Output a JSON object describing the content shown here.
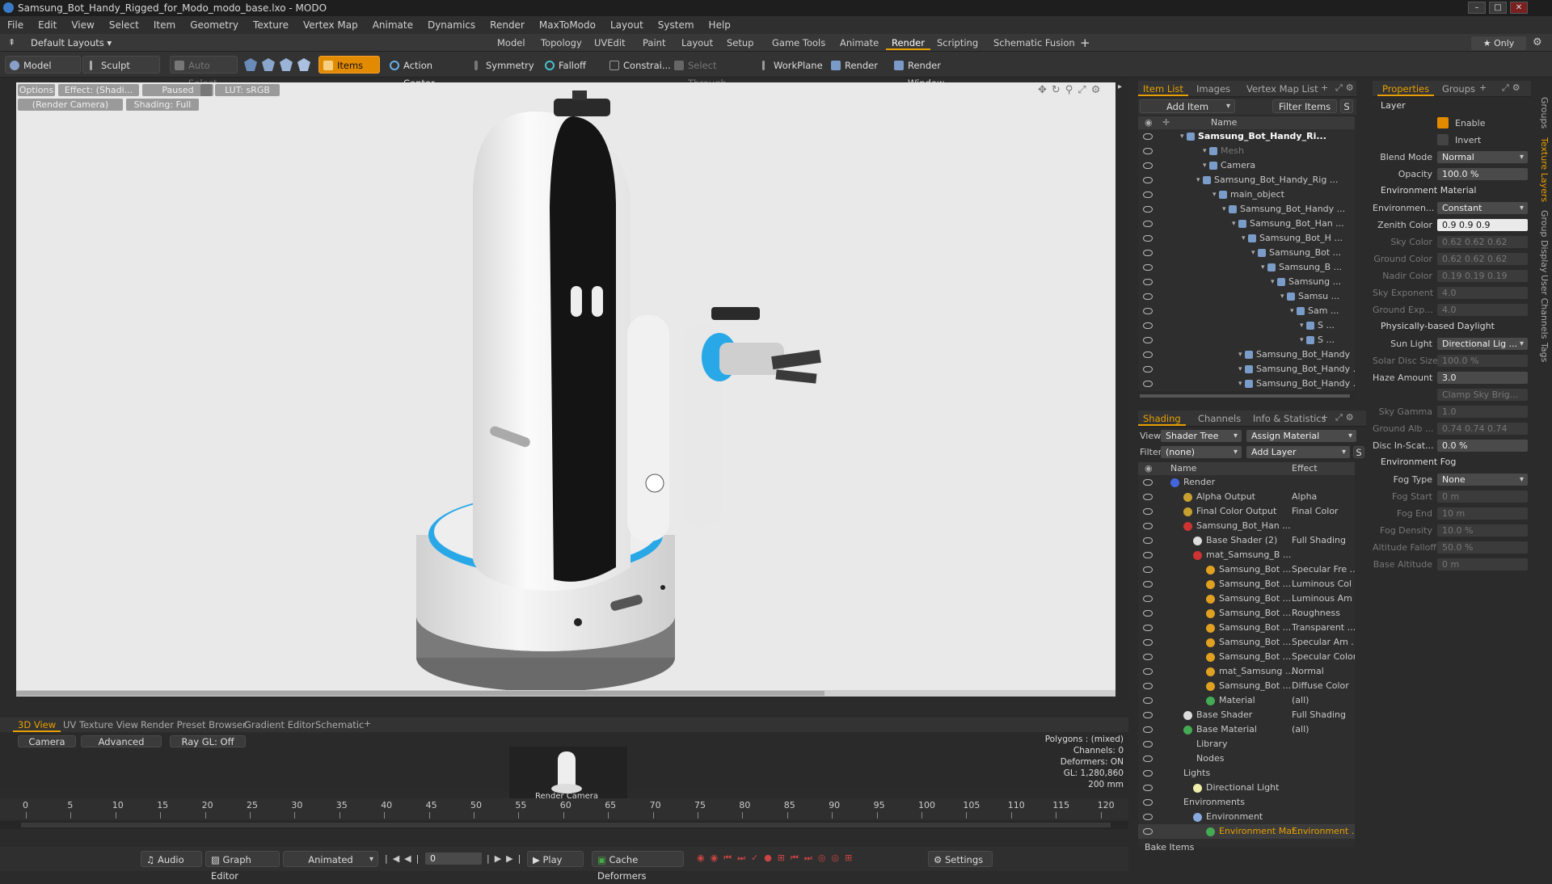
{
  "window": {
    "title": "Samsung_Bot_Handy_Rigged_for_Modo_modo_base.lxo - MODO"
  },
  "menu": [
    "File",
    "Edit",
    "View",
    "Select",
    "Item",
    "Geometry",
    "Texture",
    "Vertex Map",
    "Animate",
    "Dynamics",
    "Render",
    "MaxToModo",
    "Layout",
    "System",
    "Help"
  ],
  "layout": {
    "preset": "Default Layouts ▾",
    "tabs": [
      "Model",
      "Topology",
      "UVEdit",
      "Paint",
      "Layout",
      "Setup",
      "Game Tools",
      "Animate",
      "Render",
      "Scripting",
      "Schematic Fusion"
    ],
    "active_tab": "Render",
    "only_label": "★ Only"
  },
  "toolbar": {
    "model": "Model",
    "sculpt": "Sculpt",
    "auto_select": "Auto Select",
    "items": "Items",
    "action_center": "Action Center",
    "symmetry": "Symmetry",
    "falloff": "Falloff",
    "constrain": "Constrai...",
    "select_through": "Select Through",
    "workplane": "WorkPlane",
    "render": "Render",
    "render_window": "Render Window"
  },
  "viewport": {
    "options": "Options",
    "effect": "Effect: (Shadi...",
    "paused": "Paused",
    "lut": "LUT: sRGB",
    "camera": "(Render Camera)",
    "shading": "Shading: Full"
  },
  "itemlist": {
    "tabs": [
      "Item List",
      "Images",
      "Vertex Map List"
    ],
    "add_item": "Add Item",
    "filter_items": "Filter Items",
    "col_name": "Name",
    "rows": [
      {
        "label": "Samsung_Bot_Handy_Ri...",
        "indent": 60,
        "bold": true
      },
      {
        "label": "Mesh",
        "indent": 88,
        "dim": true
      },
      {
        "label": "Camera",
        "indent": 88
      },
      {
        "label": "Samsung_Bot_Handy_Rig ...",
        "indent": 80
      },
      {
        "label": "main_object",
        "indent": 100
      },
      {
        "label": "Samsung_Bot_Handy ...",
        "indent": 112
      },
      {
        "label": "Samsung_Bot_Han ...",
        "indent": 124
      },
      {
        "label": "Samsung_Bot_H ...",
        "indent": 136
      },
      {
        "label": "Samsung_Bot ...",
        "indent": 148
      },
      {
        "label": "Samsung_B ...",
        "indent": 160
      },
      {
        "label": "Samsung ...",
        "indent": 172
      },
      {
        "label": "Samsu ...",
        "indent": 184
      },
      {
        "label": "Sam ...",
        "indent": 196
      },
      {
        "label": "S ...",
        "indent": 208
      },
      {
        "label": "S ...",
        "indent": 208
      },
      {
        "label": "Samsung_Bot_Handy",
        "indent": 132
      },
      {
        "label": "Samsung_Bot_Handy ...",
        "indent": 132
      },
      {
        "label": "Samsung_Bot_Handy ...",
        "indent": 132
      }
    ]
  },
  "shading": {
    "tabs": [
      "Shading",
      "Channels",
      "Info & Statistics"
    ],
    "view_label": "View",
    "view_value": "Shader Tree",
    "assign_material": "Assign Material",
    "filter_label": "Filter",
    "filter_value": "(none)",
    "add_layer": "Add Layer",
    "col_name": "Name",
    "col_effect": "Effect",
    "rows": [
      {
        "label": "Render",
        "effect": "",
        "indent": 40,
        "color": "#4466dd"
      },
      {
        "label": "Alpha Output",
        "effect": "Alpha",
        "indent": 56,
        "color": "#c8a030"
      },
      {
        "label": "Final Color Output",
        "effect": "Final Color",
        "indent": 56,
        "color": "#c8a030"
      },
      {
        "label": "Samsung_Bot_Han ...",
        "effect": "",
        "indent": 56,
        "color": "#cc3333"
      },
      {
        "label": "Base Shader (2)",
        "effect": "Full Shading",
        "indent": 68,
        "color": "#dddddd"
      },
      {
        "label": "mat_Samsung_B ...",
        "effect": "",
        "indent": 68,
        "color": "#cc3333"
      },
      {
        "label": "Samsung_Bot ...",
        "effect": "Specular Fre ...",
        "indent": 84,
        "color": "#e0a020"
      },
      {
        "label": "Samsung_Bot ...",
        "effect": "Luminous Col ...",
        "indent": 84,
        "color": "#e0a020"
      },
      {
        "label": "Samsung_Bot ...",
        "effect": "Luminous Am ...",
        "indent": 84,
        "color": "#e0a020"
      },
      {
        "label": "Samsung_Bot ...",
        "effect": "Roughness",
        "indent": 84,
        "color": "#e0a020"
      },
      {
        "label": "Samsung_Bot ...",
        "effect": "Transparent ...",
        "indent": 84,
        "color": "#e0a020"
      },
      {
        "label": "Samsung_Bot ...",
        "effect": "Specular Am ...",
        "indent": 84,
        "color": "#e0a020"
      },
      {
        "label": "Samsung_Bot ...",
        "effect": "Specular Color",
        "indent": 84,
        "color": "#e0a020"
      },
      {
        "label": "mat_Samsung ...",
        "effect": "Normal",
        "indent": 84,
        "color": "#e0a020"
      },
      {
        "label": "Samsung_Bot ...",
        "effect": "Diffuse Color",
        "indent": 84,
        "color": "#e0a020"
      },
      {
        "label": "Material",
        "effect": "(all)",
        "indent": 84,
        "color": "#44aa55"
      },
      {
        "label": "Base Shader",
        "effect": "Full Shading",
        "indent": 56,
        "color": "#dddddd"
      },
      {
        "label": "Base Material",
        "effect": "(all)",
        "indent": 56,
        "color": "#44aa55"
      },
      {
        "label": "Library",
        "effect": "",
        "indent": 56,
        "color": ""
      },
      {
        "label": "Nodes",
        "effect": "",
        "indent": 56,
        "color": ""
      },
      {
        "label": "Lights",
        "effect": "",
        "indent": 40,
        "color": ""
      },
      {
        "label": "Directional Light",
        "effect": "",
        "indent": 68,
        "color": "#eeeeaa"
      },
      {
        "label": "Environments",
        "effect": "",
        "indent": 40,
        "color": ""
      },
      {
        "label": "Environment",
        "effect": "",
        "indent": 68,
        "color": "#88aadd"
      },
      {
        "label": "Environment Mat...",
        "effect": "Environment ...",
        "indent": 84,
        "color": "#44aa55",
        "selected": true
      }
    ],
    "bake_items": "Bake Items"
  },
  "properties": {
    "tabs": [
      "Properties",
      "Groups"
    ],
    "layer_title": "Layer",
    "enable": "Enable",
    "invert": "Invert",
    "fields": [
      {
        "label": "Blend Mode",
        "value": "Normal",
        "dd": true
      },
      {
        "label": "Opacity",
        "value": "100.0 %"
      }
    ],
    "env_material": "Environment Material",
    "env_fields": [
      {
        "label": "Environmen...",
        "value": "Constant",
        "dd": true
      },
      {
        "label": "Zenith Color",
        "value": "0.9   0.9   0.9",
        "hi": true
      },
      {
        "label": "Sky Color",
        "value": "0.62  0.62  0.62",
        "dim": true
      },
      {
        "label": "Ground Color",
        "value": "0.62  0.62  0.62",
        "dim": true
      },
      {
        "label": "Nadir Color",
        "value": "0.19  0.19  0.19",
        "dim": true
      },
      {
        "label": "Sky Exponent",
        "value": "4.0",
        "dim": true
      },
      {
        "label": "Ground Exp...",
        "value": "4.0",
        "dim": true
      }
    ],
    "daylight": "Physically-based Daylight",
    "day_fields": [
      {
        "label": "Sun Light",
        "value": "Directional Lig ...",
        "dd": true
      },
      {
        "label": "Solar Disc Size",
        "value": "100.0 %",
        "dim": true
      },
      {
        "label": "Haze Amount",
        "value": "3.0"
      },
      {
        "label": "",
        "value": "Clamp Sky Brig...",
        "dim": true
      },
      {
        "label": "Sky Gamma",
        "value": "1.0",
        "dim": true
      },
      {
        "label": "Ground Alb ...",
        "value": "0.74  0.74  0.74",
        "dim": true
      },
      {
        "label": "Disc In-Scat...",
        "value": "0.0 %"
      }
    ],
    "fog": "Environment Fog",
    "fog_fields": [
      {
        "label": "Fog Type",
        "value": "None",
        "dd": true
      },
      {
        "label": "Fog Start",
        "value": "0 m",
        "dim": true
      },
      {
        "label": "Fog End",
        "value": "10 m",
        "dim": true
      },
      {
        "label": "Fog Density",
        "value": "10.0 %",
        "dim": true
      },
      {
        "label": "Altitude Falloff",
        "value": "50.0 %",
        "dim": true
      },
      {
        "label": "Base Altitude",
        "value": "0 m",
        "dim": true
      }
    ],
    "sidetabs": [
      "Groups",
      "Texture Layers",
      "Group Display",
      "User Channels",
      "Tags"
    ]
  },
  "bottom": {
    "tabs": [
      "3D View",
      "UV Texture View",
      "Render Preset Browser",
      "Gradient Editor",
      "Schematic"
    ],
    "camera": "Camera",
    "advanced": "Advanced",
    "raygl": "Ray GL: Off",
    "render_camera": "Render Camera",
    "stats": [
      "Polygons : (mixed)",
      "Channels: 0",
      "Deformers: ON",
      "GL: 1,280,860",
      "200 mm"
    ],
    "ticks": [
      0,
      5,
      10,
      15,
      20,
      25,
      30,
      35,
      40,
      45,
      50,
      55,
      60,
      65,
      70,
      75,
      80,
      85,
      90,
      95,
      100,
      105,
      110,
      115,
      120
    ],
    "audio": "Audio",
    "graph_editor": "Graph Editor",
    "animated": "Animated",
    "frame": "0",
    "play": "Play",
    "cache": "Cache Deformers",
    "settings": "Settings"
  },
  "colors": {
    "accent": "#e38b00",
    "ring": "#29a8e8",
    "robot_black": "#151515",
    "robot_white": "#f0f0f0"
  }
}
